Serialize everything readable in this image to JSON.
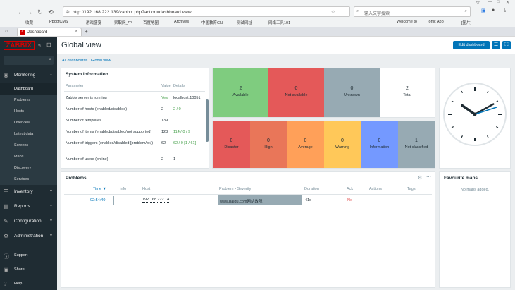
{
  "browser": {
    "url": "http://192.168.222.139/zabbix.php?action=dashboard.view",
    "search_placeholder": "输入文字搜索",
    "tab_title": "Dashboard",
    "bookmarks": [
      "收藏",
      "PbootCMS",
      "游戏盛宴",
      "索取网_中",
      "百度地图",
      "Archives",
      "中国教育CN",
      "测试网址",
      "网络工具101",
      "Welcome to",
      "Ionic App",
      "[图片]"
    ],
    "window_controls": [
      "—",
      "□",
      "✕"
    ]
  },
  "sidebar": {
    "logo": "ZABBIX",
    "sections": [
      {
        "label": "Monitoring",
        "icon": "eye-icon"
      },
      {
        "label": "Inventory",
        "icon": "list-icon"
      },
      {
        "label": "Reports",
        "icon": "report-icon"
      },
      {
        "label": "Configuration",
        "icon": "wrench-icon"
      },
      {
        "label": "Administration",
        "icon": "gear-icon"
      }
    ],
    "monitoring_items": [
      "Dashboard",
      "Problems",
      "Hosts",
      "Overview",
      "Latest data",
      "Screens",
      "Maps",
      "Discovery",
      "Services"
    ],
    "bottom": [
      {
        "label": "Support",
        "icon": "help-icon"
      },
      {
        "label": "Share",
        "icon": "share-icon"
      },
      {
        "label": "Help",
        "icon": "question-icon"
      }
    ]
  },
  "header": {
    "title": "Global view",
    "edit_button": "Edit dashboard",
    "breadcrumb": [
      "All dashboards",
      "Global view"
    ]
  },
  "system_info": {
    "title": "System information",
    "columns": [
      "Parameter",
      "Value",
      "Details"
    ],
    "rows": [
      {
        "param": "Zabbix server is running",
        "value": "Yes",
        "details": "localhost:10051"
      },
      {
        "param": "Number of hosts (enabled/disabled)",
        "value": "2",
        "details": "2 / 0"
      },
      {
        "param": "Number of templates",
        "value": "139",
        "details": ""
      },
      {
        "param": "Number of items (enabled/disabled/not supported)",
        "value": "123",
        "details": "114 / 0 / 9"
      },
      {
        "param": "Number of triggers (enabled/disabled [problem/ok])",
        "value": "62",
        "details": "62 / 0 [1 / 61]"
      },
      {
        "param": "Number of users (online)",
        "value": "2",
        "details": "1"
      }
    ]
  },
  "availability": [
    {
      "count": "2",
      "label": "Available",
      "color": "#7fcc7f"
    },
    {
      "count": "0",
      "label": "Not available",
      "color": "#e45959"
    },
    {
      "count": "0",
      "label": "Unknown",
      "color": "#97aab3"
    },
    {
      "count": "2",
      "label": "Total",
      "color": "#ffffff"
    }
  ],
  "severity": [
    {
      "count": "0",
      "label": "Disaster",
      "color": "#e45959"
    },
    {
      "count": "0",
      "label": "High",
      "color": "#e97659"
    },
    {
      "count": "0",
      "label": "Average",
      "color": "#ffa059"
    },
    {
      "count": "0",
      "label": "Warning",
      "color": "#ffc859"
    },
    {
      "count": "0",
      "label": "Information",
      "color": "#7499ff"
    },
    {
      "count": "1",
      "label": "Not classified",
      "color": "#97aab3"
    }
  ],
  "problems": {
    "title": "Problems",
    "columns": [
      "Time ▼",
      "Info",
      "Host",
      "Problem • Severity",
      "Duration",
      "Ack",
      "Actions",
      "Tags"
    ],
    "rows": [
      {
        "time": "02:54:40",
        "host": "192.168.222.14",
        "problem": "www.baidu.com网站故障",
        "duration": "41s",
        "ack": "No"
      }
    ]
  },
  "favourite_maps": {
    "title": "Favourite maps",
    "empty": "No maps added."
  },
  "clock": {
    "hour": 10,
    "minute": 10,
    "second": 12
  }
}
